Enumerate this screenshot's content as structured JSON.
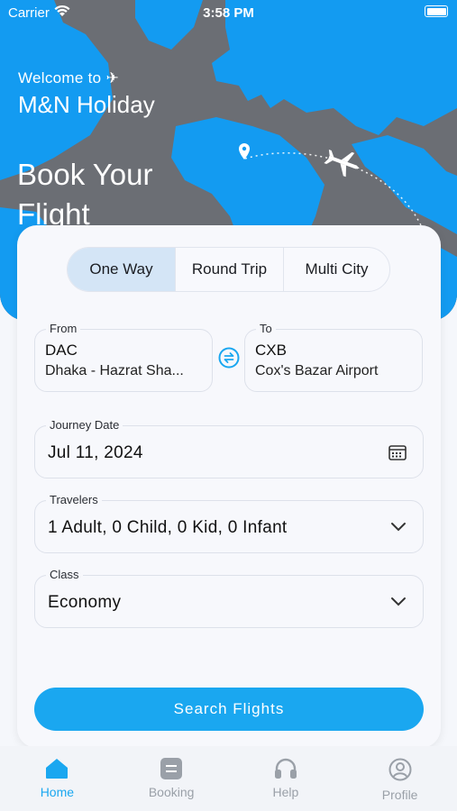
{
  "status_bar": {
    "carrier": "Carrier",
    "time": "3:58 PM"
  },
  "hero": {
    "welcome": "Welcome to ✈",
    "brand": "M&N Holiday",
    "headline": "Book Your Flight"
  },
  "trip_tabs": [
    {
      "label": "One Way",
      "active": true
    },
    {
      "label": "Round Trip",
      "active": false
    },
    {
      "label": "Multi City",
      "active": false
    }
  ],
  "from": {
    "label": "From",
    "code": "DAC",
    "airport": "Dhaka - Hazrat Sha..."
  },
  "to": {
    "label": "To",
    "code": "CXB",
    "airport": "Cox's Bazar Airport"
  },
  "journey_date": {
    "label": "Journey Date",
    "value": "Jul 11, 2024"
  },
  "travelers": {
    "label": "Travelers",
    "value": "1 Adult, 0 Child, 0 Kid, 0 Infant"
  },
  "travel_class": {
    "label": "Class",
    "value": "Economy"
  },
  "search_button": "Search Flights",
  "bottom_nav": [
    {
      "label": "Home",
      "icon": "home-icon",
      "active": true
    },
    {
      "label": "Booking",
      "icon": "booking-icon",
      "active": false
    },
    {
      "label": "Help",
      "icon": "headset-icon",
      "active": false
    },
    {
      "label": "Profile",
      "icon": "profile-icon",
      "active": false
    }
  ],
  "colors": {
    "accent": "#1aa7f0",
    "map_land": "#139bf1",
    "map_sea": "#6b6e74",
    "active_tab": "#d4e5f6"
  }
}
